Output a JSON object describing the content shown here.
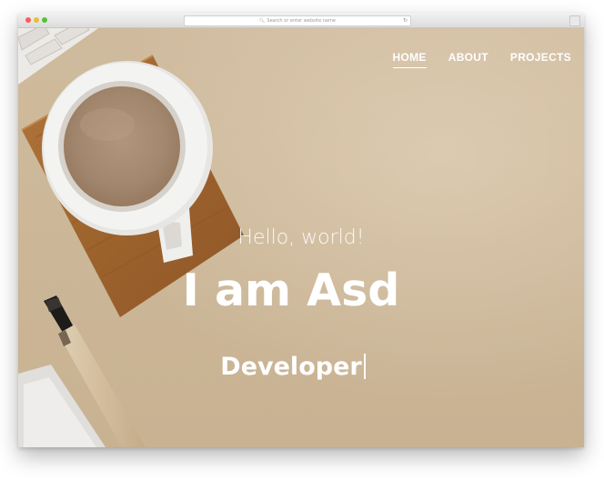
{
  "browser": {
    "url_placeholder": "Search or enter website name"
  },
  "nav": {
    "items": [
      {
        "label": "HOME",
        "active": true
      },
      {
        "label": "ABOUT",
        "active": false
      },
      {
        "label": "PROJECTS",
        "active": false
      }
    ]
  },
  "hero": {
    "greeting": "Hello, world!",
    "headline": "I am Asd",
    "role": "Developer"
  },
  "colors": {
    "background": "#d4bfa1",
    "text": "#ffffff"
  }
}
